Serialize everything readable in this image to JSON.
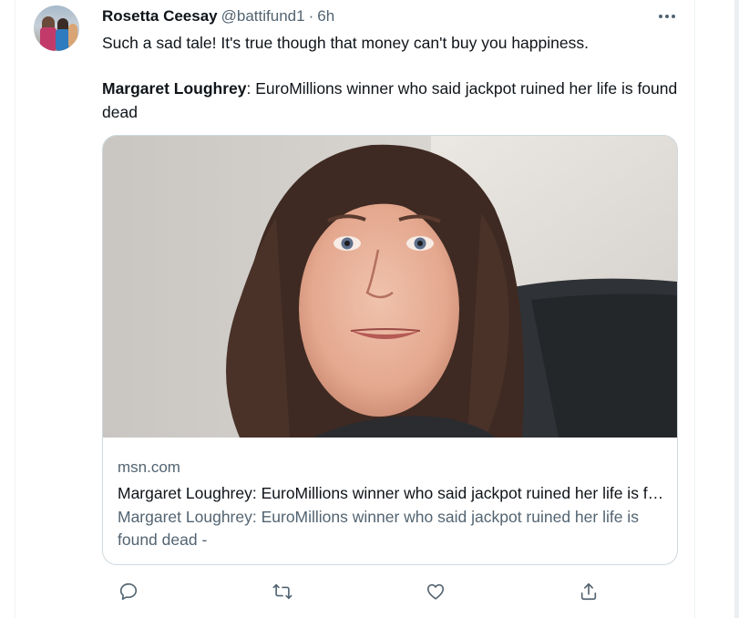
{
  "tweet": {
    "author_name": "Rosetta Ceesay",
    "handle": "@battifund1",
    "separator": "·",
    "time": "6h",
    "text_line1": "Such a sad tale!  It's true though that money can't buy you happiness.",
    "quote_bold": "Margaret Loughrey",
    "quote_rest": ": EuroMillions winner who said jackpot ruined her life is found dead",
    "icons": {
      "more": "more-horizontal-icon",
      "reply": "reply-icon",
      "retweet": "retweet-icon",
      "like": "heart-icon",
      "share": "share-icon"
    }
  },
  "card": {
    "domain": "msn.com",
    "title": "Margaret Loughrey: EuroMillions winner who said jackpot ruined her life is found dead",
    "description": "Margaret Loughrey: EuroMillions winner who said jackpot ruined her life is found dead -"
  },
  "colors": {
    "text": "#0f1419",
    "secondary": "#536471",
    "border": "#cfd9de"
  }
}
